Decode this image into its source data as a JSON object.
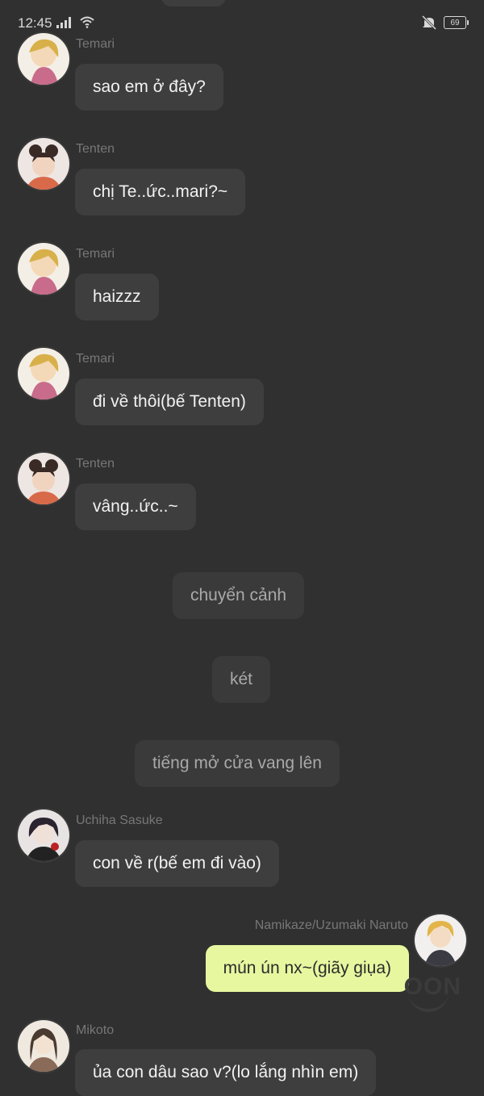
{
  "status_bar": {
    "time": "12:45",
    "battery": "69",
    "icons": [
      "signal-icon",
      "wifi-icon",
      "mute-icon",
      "battery-icon"
    ]
  },
  "chat": {
    "messages": [
      {
        "sender": "Temari",
        "text": "sao em ở đây?",
        "avatar": "temari-avatar"
      },
      {
        "sender": "Tenten",
        "text": "chị Te..ức..mari?~",
        "avatar": "tenten-avatar"
      },
      {
        "sender": "Temari",
        "text": "haizzz",
        "avatar": "temari-avatar"
      },
      {
        "sender": "Temari",
        "text": "đi về thôi(bế Tenten)",
        "avatar": "temari-avatar"
      },
      {
        "sender": "Tenten",
        "text": "vâng..ức..~",
        "avatar": "tenten-avatar"
      },
      {
        "sender": "Uchiha Sasuke",
        "text": "con về r(bế em đi vào)",
        "avatar": "sasuke-avatar"
      },
      {
        "sender": "Namikaze/Uzumaki Naruto",
        "text": "mún ún nx~(giãy giụa)",
        "avatar": "naruto-avatar"
      },
      {
        "sender": "Mikoto",
        "text": "ủa con dâu sao v?(lo lắng nhìn em)",
        "avatar": "mikoto-avatar"
      }
    ],
    "narrations": [
      "chuyển cảnh",
      "két",
      "tiếng mở cửa vang lên"
    ]
  },
  "watermark": "OON",
  "colors": {
    "background": "#303030",
    "bubble": "#3e3e3e",
    "own_bubble": "#e6f7a0",
    "sender_text": "#777777"
  }
}
